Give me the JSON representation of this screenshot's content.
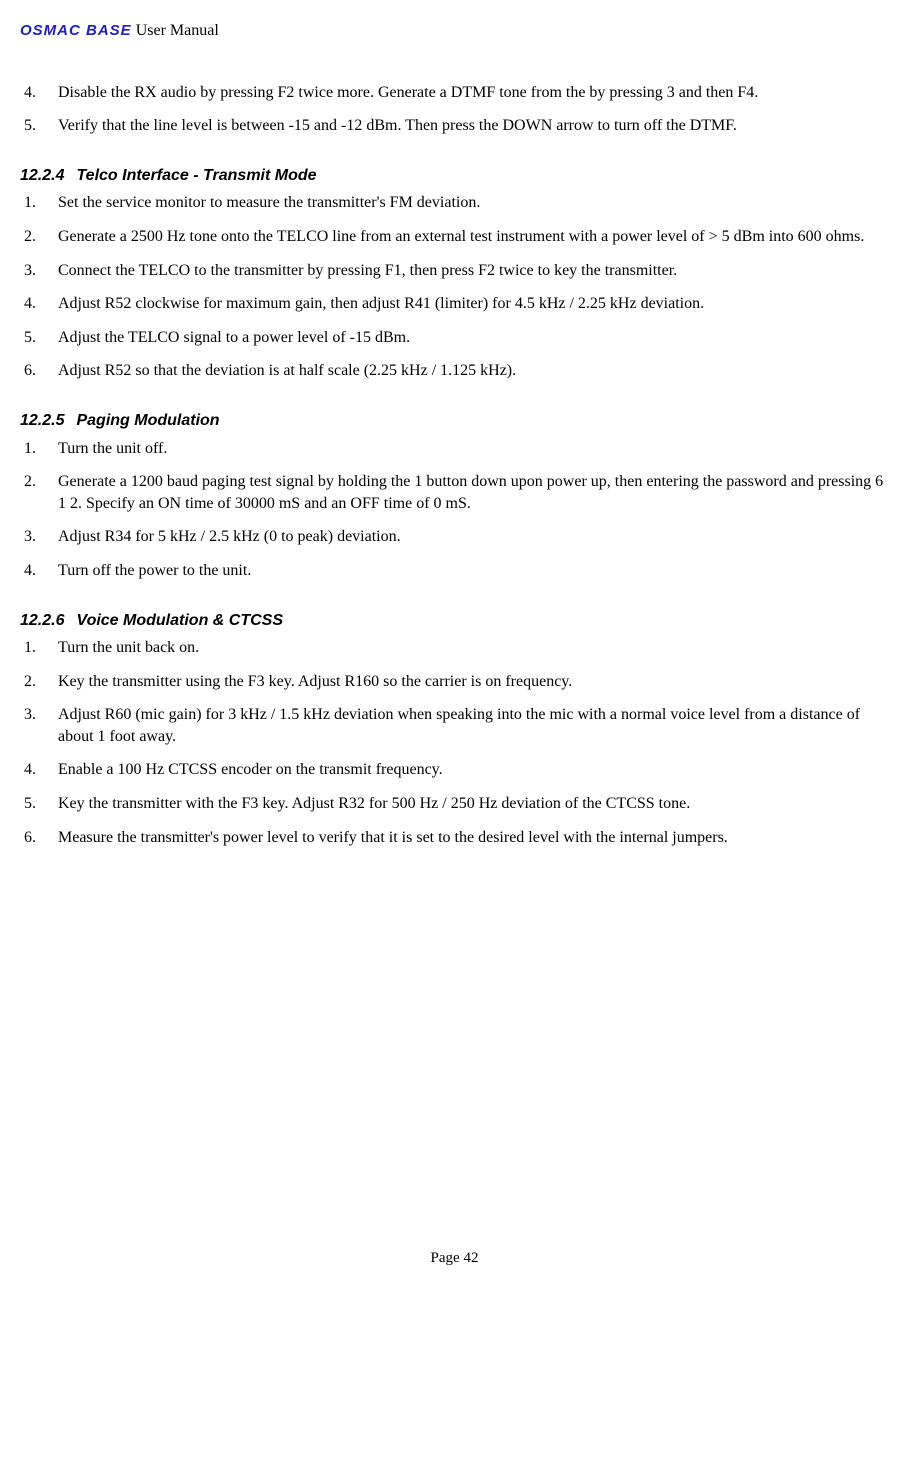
{
  "header": {
    "brand": "OSMAC BASE",
    "rest": " User Manual"
  },
  "top_list": {
    "start": 4,
    "items": [
      "Disable the RX audio by pressing F2 twice more. Generate a DTMF tone from the  by pressing 3 and then F4.",
      "Verify that the line level is between -15 and -12 dBm.  Then press the DOWN arrow to turn off the DTMF."
    ]
  },
  "s1": {
    "num": "12.2.4",
    "title": "Telco Interface - Transmit Mode",
    "items": [
      "Set the service monitor to measure the transmitter's FM deviation.",
      "Generate a 2500 Hz tone onto the TELCO line from an external test instrument with a power level of > 5 dBm into 600 ohms.",
      "Connect the TELCO to the transmitter by pressing F1, then press F2 twice to key the transmitter.",
      "Adjust R52 clockwise for maximum gain, then adjust R41 (limiter) for 4.5 kHz / 2.25 kHz deviation.",
      "Adjust the TELCO signal to a power level of -15 dBm.",
      "Adjust R52 so that the deviation is at half scale (2.25 kHz / 1.125 kHz)."
    ]
  },
  "s2": {
    "num": "12.2.5",
    "title": "Paging Modulation",
    "items": [
      "Turn the unit off.",
      "Generate a 1200 baud paging test signal by holding the 1 button down upon power up, then entering the password and pressing  6 1 2.  Specify an ON time of 30000 mS and an OFF time of 0 mS.",
      "Adjust R34 for 5 kHz / 2.5 kHz (0 to peak) deviation.",
      "Turn off the power to the unit."
    ]
  },
  "s3": {
    "num": "12.2.6",
    "title": "Voice Modulation & CTCSS",
    "items": [
      "Turn the unit back on.",
      "Key the transmitter using the F3 key.   Adjust R160 so the carrier is on frequency.",
      "Adjust R60 (mic gain) for 3 kHz / 1.5 kHz deviation when speaking into the mic with a normal voice level from a distance of about 1 foot away.",
      "Enable a 100 Hz CTCSS encoder on the transmit frequency.",
      "Key the transmitter with the F3 key.  Adjust R32 for 500 Hz / 250 Hz deviation of the CTCSS tone.",
      "Measure the transmitter's power level to verify that it is set to the desired level with the internal jumpers."
    ]
  },
  "footer": "Page 42"
}
